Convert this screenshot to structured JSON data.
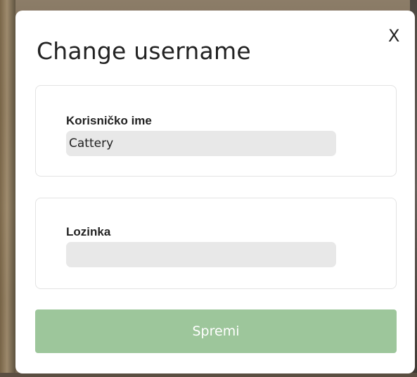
{
  "modal": {
    "title": "Change username",
    "close_label": "X"
  },
  "fields": {
    "username": {
      "label": "Korisničko ime",
      "value": "Cattery",
      "placeholder": ""
    },
    "password": {
      "label": "Lozinka",
      "value": "",
      "placeholder": ""
    }
  },
  "actions": {
    "save_label": "Spremi"
  },
  "colors": {
    "save_button_bg": "#9dc69b",
    "input_bg": "#e8e8e8",
    "card_border": "#e3e3e3"
  }
}
